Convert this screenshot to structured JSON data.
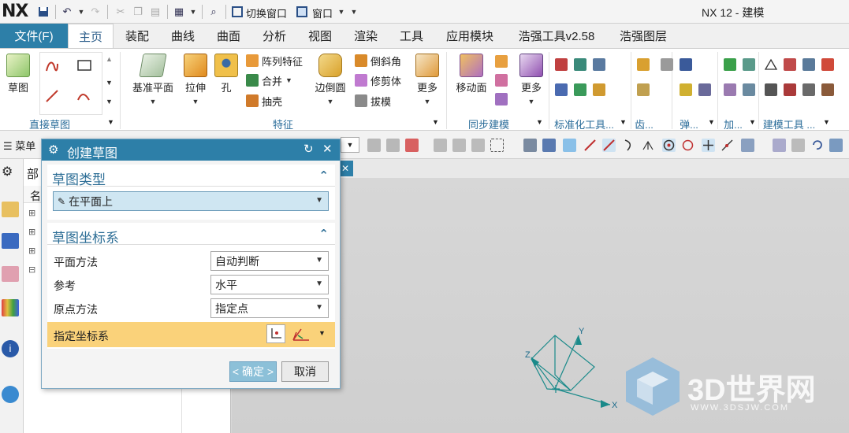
{
  "app": {
    "logo": "NX",
    "window_title": "NX 12 - 建模"
  },
  "quick_access": {
    "switch_window": "切换窗口",
    "window": "窗口"
  },
  "menu": {
    "file": "文件(F)",
    "tabs": [
      "主页",
      "装配",
      "曲线",
      "曲面",
      "分析",
      "视图",
      "渲染",
      "工具",
      "应用模块",
      "浩强工具v2.58",
      "浩强图层"
    ],
    "active_tab": "主页"
  },
  "ribbon": {
    "sketch": "草图",
    "direct_sketch_group": "直接草图",
    "datum_plane": "基准平面",
    "extrude": "拉伸",
    "hole": "孔",
    "pattern_feature": "阵列特征",
    "unite": "合并",
    "shell": "抽壳",
    "edge_blend": "边倒圆",
    "chamfer": "倒斜角",
    "trim_body": "修剪体",
    "draft": "拔模",
    "more": "更多",
    "feature_group": "特征",
    "move_face": "移动面",
    "more2": "更多",
    "sync_group": "同步建模",
    "std_tools_group": "标准化工具...",
    "gear_group": "齿...",
    "spring_group": "弹...",
    "add_group": "加...",
    "modeling_tools_group": "建模工具 ..."
  },
  "toolbar": {
    "menu": "菜单"
  },
  "nav": {
    "part_label": "部",
    "name_label": "名"
  },
  "dialog": {
    "title": "创建草图",
    "sketch_type_section": "草图类型",
    "sketch_type_value": "在平面上",
    "csys_section": "草图坐标系",
    "plane_method_label": "平面方法",
    "plane_method_value": "自动判断",
    "reference_label": "参考",
    "reference_value": "水平",
    "origin_method_label": "原点方法",
    "origin_method_value": "指定点",
    "specify_csys_label": "指定坐标系",
    "ok": "< 确定 >",
    "cancel": "取消"
  },
  "triad": {
    "x": "X",
    "y": "Y",
    "z": "Z"
  },
  "watermark": {
    "brand": "3D世界网",
    "url": "WWW.3DSJW.COM"
  },
  "colors": {
    "accent": "#2d7fa8",
    "highlight": "#fad27a",
    "triad": "#1a8a8a"
  }
}
